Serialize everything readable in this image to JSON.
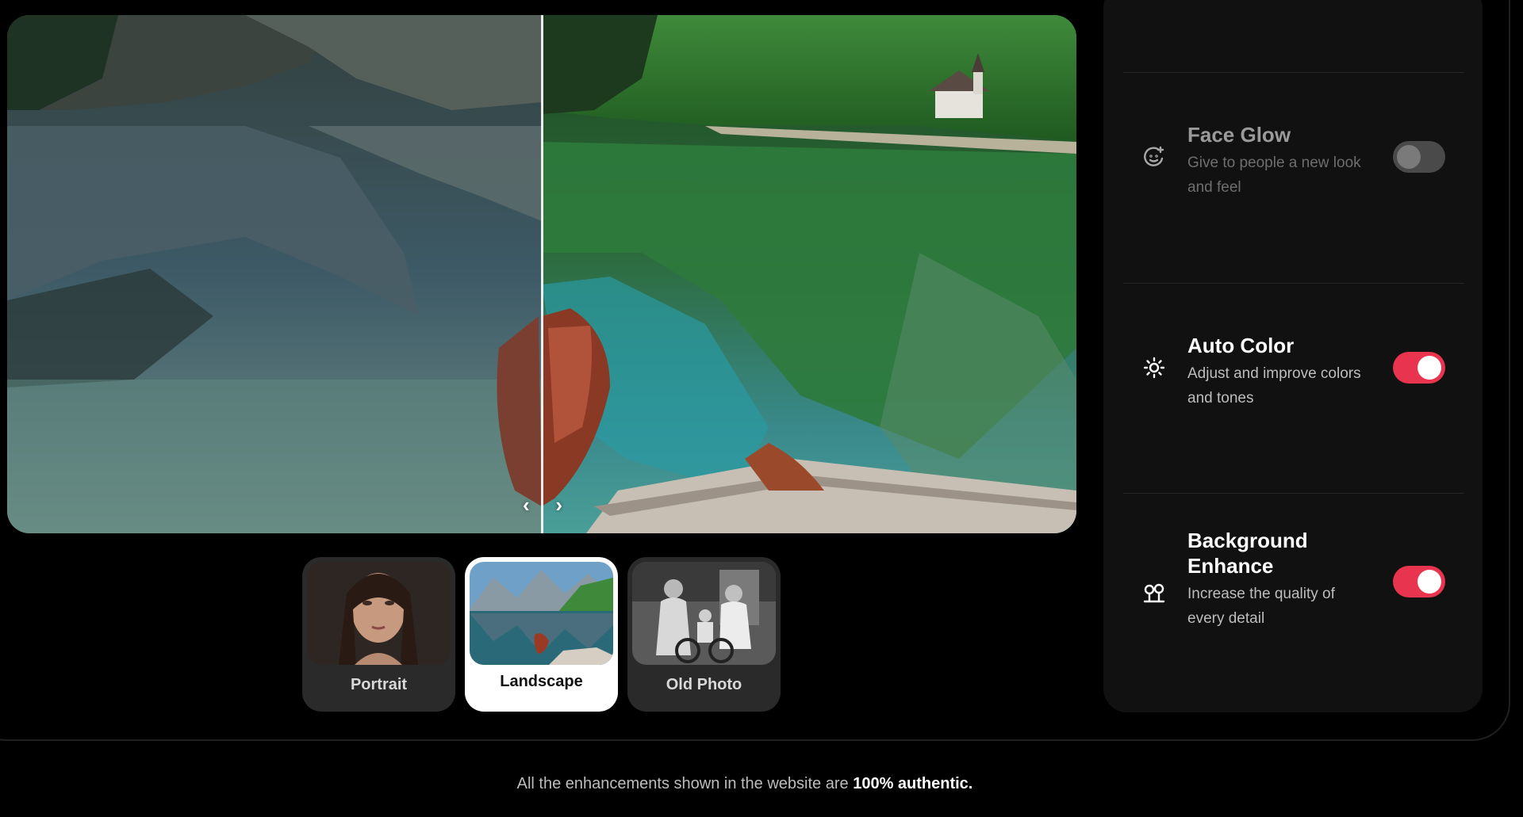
{
  "comparison": {
    "divider_position": 0.5,
    "prev_glyph": "‹",
    "next_glyph": "›"
  },
  "samples": [
    {
      "label": "Portrait",
      "active": false,
      "icon": "portrait-thumbnail"
    },
    {
      "label": "Landscape",
      "active": true,
      "icon": "landscape-thumbnail"
    },
    {
      "label": "Old Photo",
      "active": false,
      "icon": "old-photo-thumbnail"
    }
  ],
  "features": [
    {
      "title": "Face Glow",
      "description": "Give to people a new look and feel",
      "enabled": false,
      "icon": "face-glow-icon"
    },
    {
      "title": "Auto Color",
      "description": "Adjust and improve colors and tones",
      "enabled": true,
      "icon": "sun-icon"
    },
    {
      "title": "Background Enhance",
      "description": "Increase the quality of every detail",
      "enabled": true,
      "icon": "trees-icon"
    }
  ],
  "footer": {
    "text": "All the enhancements shown in the website are ",
    "highlight": "100% authentic."
  },
  "colors": {
    "accent": "#e8344f",
    "toggle_off": "#4a4a4a",
    "panel_bg": "#111111",
    "page_bg": "#000000"
  }
}
